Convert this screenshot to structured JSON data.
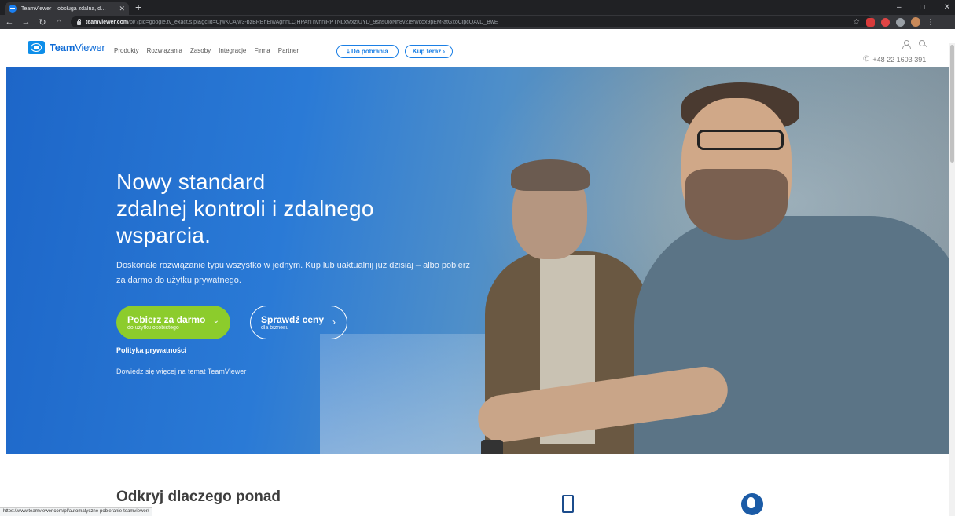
{
  "browser": {
    "tab_title": "TeamViewer – obsługa zdalna, d…",
    "url_host": "teamviewer.com",
    "url_path": "/pl/?pid=google.tv_exact.s.pl&gclid=CjwKCAjw3-bzBRBhEiwAgnnLCjHPArTnvhniRPTNLxMxzIUYD_9shs0IoNh8vZierwcdx9pEM-atGxoCipcQAvD_BwE",
    "new_tab_glyph": "+",
    "window_controls": [
      "–",
      "□",
      "✕"
    ],
    "status_url": "https://www.teamviewer.com/pl/automatyczne-pobieranie-teamviewer/"
  },
  "header": {
    "logo_team": "Team",
    "logo_viewer": "Viewer",
    "nav": [
      "Produkty",
      "Rozwiązania",
      "Zasoby",
      "Integracje",
      "Firma",
      "Partner"
    ],
    "download_label": "⤓ Do pobrania",
    "buy_label": "Kup teraz ›",
    "phone": "+48 22 1603 391"
  },
  "hero": {
    "title_line1": "Nowy standard",
    "title_line2": "zdalnej kontroli i zdalnego",
    "title_line3": "wsparcia.",
    "subtitle": "Doskonałe rozwiązanie typu wszystko w jednym. Kup lub uaktualnij już dzisiaj – albo pobierz za darmo do użytku prywatnego.",
    "cta_free_main": "Pobierz za darmo",
    "cta_free_sub": "do użytku osobistego",
    "cta_prices_main": "Sprawdź ceny",
    "cta_prices_sub": "dla biznesu",
    "privacy_link": "Polityka prywatności",
    "learn_more": "Dowiedz się więcej na temat TeamViewer"
  },
  "below": {
    "discover_heading": "Odkryj dlaczego ponad"
  },
  "colors": {
    "brand_blue": "#0e6bd6",
    "accent_green": "#8ccc2c",
    "hero_blue": "#1d66c8"
  }
}
